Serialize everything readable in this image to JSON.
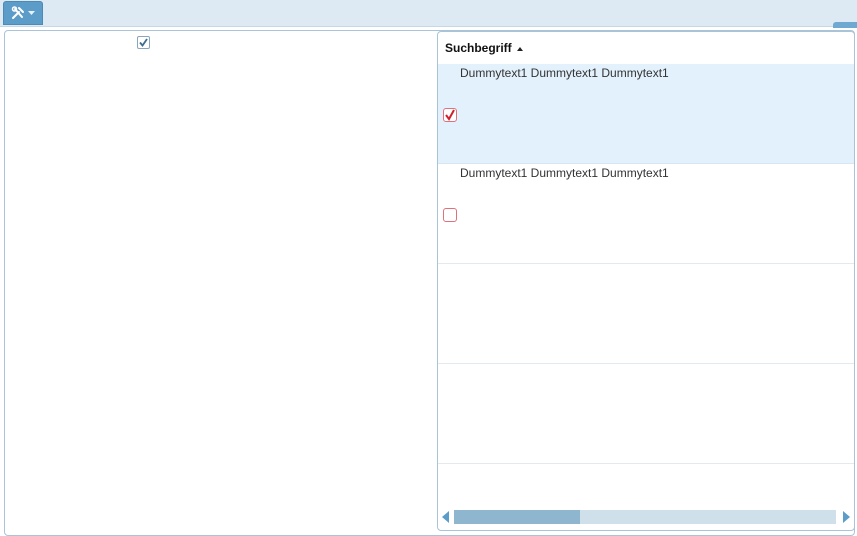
{
  "toolbar": {
    "tools_icon": "tools-icon",
    "dropdown_icon": "chevron-down-icon"
  },
  "master_checkbox": {
    "checked": true
  },
  "grid": {
    "column_header": "Suchbegriff",
    "sort_direction": "ascending",
    "rows": [
      {
        "text": "Dummytext1 Dummytext1 Dummytext1",
        "checked": true,
        "selected": true
      },
      {
        "text": "Dummytext1 Dummytext1 Dummytext1",
        "checked": false,
        "selected": false
      },
      {
        "text": "",
        "checked": null,
        "selected": false
      },
      {
        "text": "",
        "checked": null,
        "selected": false
      },
      {
        "text": "",
        "checked": null,
        "selected": false
      }
    ],
    "horizontal_scroll_position": 0.33
  },
  "colors": {
    "accent": "#5c9cc9",
    "selected_row": "#e3f1fc",
    "checkbox_border": "#e0707a",
    "checkmark": "#d0202e"
  }
}
